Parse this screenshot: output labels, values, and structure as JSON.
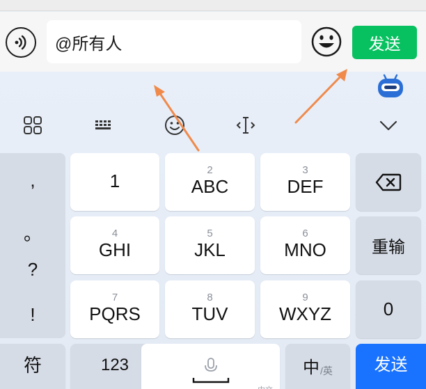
{
  "input_bar": {
    "message_value": "@所有人",
    "send_label": "发送"
  },
  "toolbar": {
    "icons": [
      "grid-icon",
      "keyboard-icon",
      "emoji-icon",
      "cursor-icon",
      "collapse-chevron-icon"
    ]
  },
  "keyboard": {
    "punctuation": [
      ",",
      "。",
      "?",
      "!"
    ],
    "rows": [
      [
        {
          "sub": "",
          "main": "1"
        },
        {
          "sub": "2",
          "main": "ABC"
        },
        {
          "sub": "3",
          "main": "DEF"
        }
      ],
      [
        {
          "sub": "4",
          "main": "GHI"
        },
        {
          "sub": "5",
          "main": "JKL"
        },
        {
          "sub": "6",
          "main": "MNO"
        }
      ],
      [
        {
          "sub": "7",
          "main": "PQRS"
        },
        {
          "sub": "8",
          "main": "TUV"
        },
        {
          "sub": "9",
          "main": "WXYZ"
        }
      ]
    ],
    "delete_icon": "backspace-icon",
    "retype_label": "重输",
    "zero_label": "0",
    "symbol_label": "符",
    "num_label": "123",
    "lang_main": "中",
    "lang_sub": "/英",
    "space_hint": "中文",
    "enter_label": "发送"
  },
  "colors": {
    "send_green": "#07c160",
    "enter_blue": "#1a73ff",
    "annotation_arrow": "#f08a4b"
  }
}
